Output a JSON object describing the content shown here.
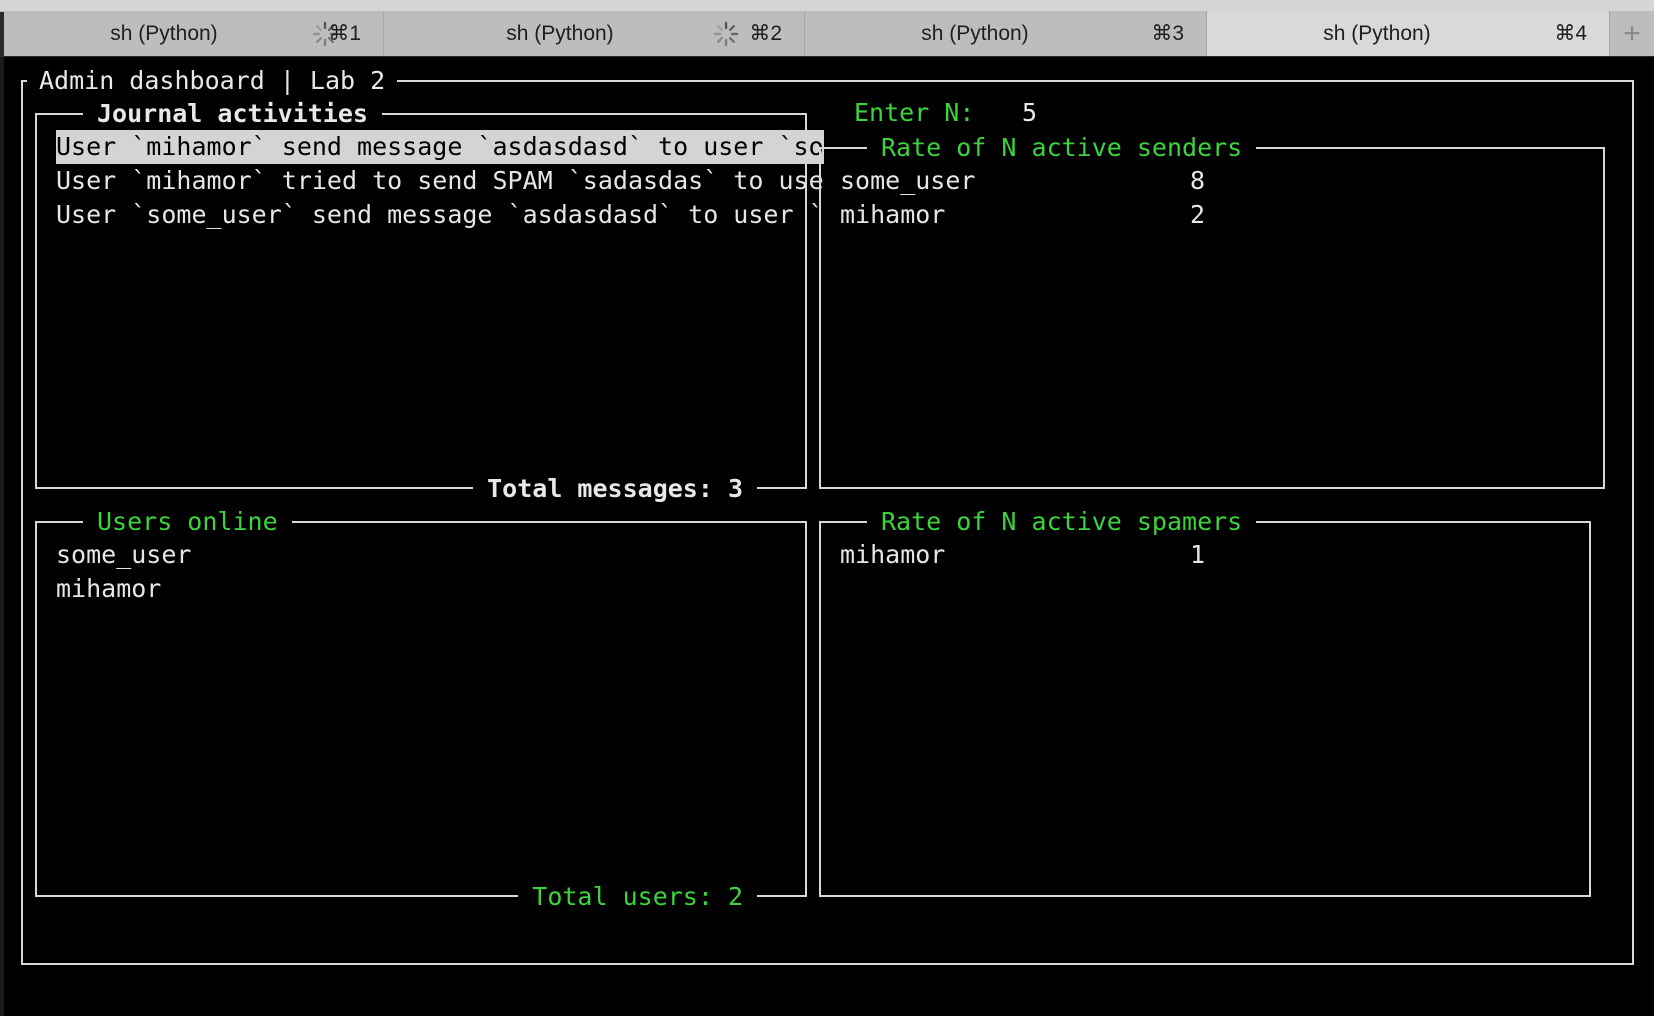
{
  "tabs": [
    {
      "title": "sh (Python)",
      "shortcut": "⌘1",
      "busy": true
    },
    {
      "title": "sh (Python)",
      "shortcut": "⌘2",
      "busy": true
    },
    {
      "title": "sh (Python)",
      "shortcut": "⌘3",
      "busy": false
    },
    {
      "title": "sh (Python)",
      "shortcut": "⌘4",
      "busy": false,
      "active": true
    }
  ],
  "new_tab_label": "+",
  "dashboard": {
    "title": "Admin dashboard | Lab 2",
    "journal": {
      "title": "Journal activities",
      "entries": [
        "User `mihamor` send message `asdasdasd` to user `so",
        "User `mihamor` tried to send SPAM `sadasdas` to use",
        "User `some_user` send message `asdasdasd` to user `"
      ],
      "footer": "Total messages: 3"
    },
    "enter_n": {
      "label": "Enter N:",
      "value": "5"
    },
    "senders": {
      "title": "Rate of N active senders",
      "rows": [
        {
          "name": "some_user",
          "count": "8"
        },
        {
          "name": "mihamor",
          "count": "2"
        }
      ]
    },
    "users_online": {
      "title": "Users online",
      "users": [
        "some_user",
        "mihamor"
      ],
      "footer": "Total users: 2"
    },
    "spamers": {
      "title": "Rate of N active spamers",
      "rows": [
        {
          "name": "mihamor",
          "count": "1"
        }
      ]
    }
  },
  "colors": {
    "accent_green": "#3cd33c",
    "border": "#d8d8d8",
    "background": "#000000",
    "selection": "#d4d4d4"
  }
}
